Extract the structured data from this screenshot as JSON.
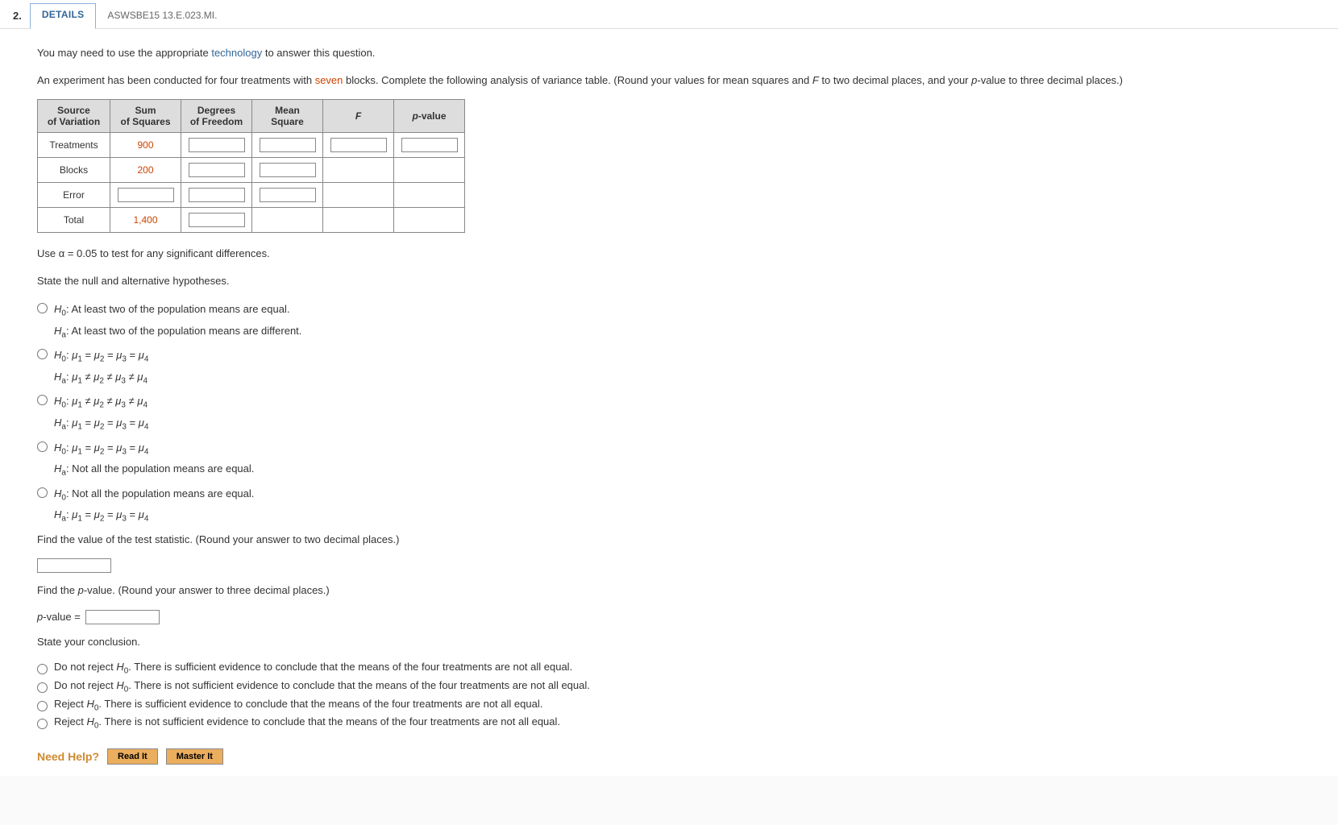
{
  "header": {
    "qnum": "2.",
    "detailsTab": "DETAILS",
    "ref": "ASWSBE15 13.E.023.MI."
  },
  "intro": {
    "prefix": "You may need to use the appropriate ",
    "techWord": "technology",
    "suffix": " to answer this question."
  },
  "prompt": {
    "p1": "An experiment has been conducted for four treatments with ",
    "blocks": "seven",
    "p2": " blocks. Complete the following analysis of variance table. (Round your values for mean squares and ",
    "fvar": "F",
    "p3": " to two decimal places, and your ",
    "pvar": "p",
    "p4": "-value to three decimal places.)"
  },
  "tableHeaders": {
    "src1": "Source",
    "src2": "of Variation",
    "ss1": "Sum",
    "ss2": "of Squares",
    "df1": "Degrees",
    "df2": "of Freedom",
    "ms1": "Mean",
    "ms2": "Square",
    "f": "F",
    "p": "p",
    "pval": "-value"
  },
  "rows": {
    "treatments": {
      "label": "Treatments",
      "ss": "900"
    },
    "blocks": {
      "label": "Blocks",
      "ss": "200"
    },
    "error": {
      "label": "Error"
    },
    "total": {
      "label": "Total",
      "ss": "1,400"
    }
  },
  "alphaLine": "Use α = 0.05 to test for any significant differences.",
  "hypHeader": "State the null and alternative hypotheses.",
  "hyp": {
    "h0": "H",
    "zero": "0",
    "ha": "H",
    "a": "a",
    "mu": "μ",
    "n1": "1",
    "n2": "2",
    "n3": "3",
    "n4": "4",
    "opt1_h0": ": At least two of the population means are equal.",
    "opt1_ha": ": At least two of the population means are different.",
    "opt4_ha": ": Not all the population means are equal.",
    "opt5_h0": ": Not all the population means are equal."
  },
  "testStat": {
    "prompt": "Find the value of the test statistic. (Round your answer to two decimal places.)"
  },
  "pvalue": {
    "prompt_a": "Find the ",
    "prompt_b": "p",
    "prompt_c": "-value. (Round your answer to three decimal places.)",
    "label_a": "p",
    "label_b": "-value ="
  },
  "conclHeader": "State your conclusion.",
  "concl": {
    "dnr": "Do not reject ",
    "rej": "Reject ",
    "txt1": ". There is sufficient evidence to conclude that the means of the four treatments are not all equal.",
    "txt2": ". There is not sufficient evidence to conclude that the means of the four treatments are not all equal.",
    "txt3": ". There is sufficient evidence to conclude that the means of the four treatments are not all equal.",
    "txt4": ". There is not sufficient evidence to conclude that the means of the four treatments are not all equal."
  },
  "help": {
    "label": "Need Help?",
    "read": "Read It",
    "master": "Master It"
  }
}
